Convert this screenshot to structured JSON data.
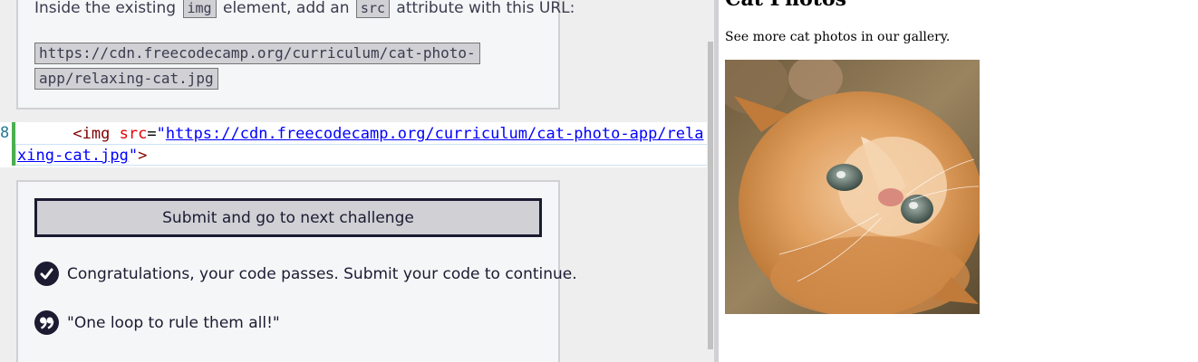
{
  "instructions": {
    "text_before": "Inside the existing",
    "code_img": "img",
    "text_middle": "element, add an",
    "code_src": "src",
    "text_after": "attribute with this URL:",
    "url_line1": "https://cdn.freecodecamp.org/curriculum/cat-photo-",
    "url_line2": "app/relaxing-cat.jpg"
  },
  "editor": {
    "line_number": "8",
    "open_bracket": "<",
    "tag": "img",
    "attr": "src",
    "eq": "=",
    "quote_open": "\"",
    "url_part1": "https://cdn.freecodecamp.org/curriculum/cat-photo-app/",
    "url_part2": "relaxing-cat.jpg",
    "quote_close": "\"",
    "close_bracket": ">"
  },
  "panel": {
    "submit_label": "Submit and go to next challenge",
    "success_message": "Congratulations, your code passes. Submit your code to continue.",
    "quote_message": "\"One loop to rule them all!\""
  },
  "preview": {
    "heading": "Cat Photos",
    "paragraph": "See more cat photos in our gallery."
  },
  "colors": {
    "gutter_modified": "#4caf50",
    "button_border": "#1b1b32",
    "panel_bg": "#f5f6f7"
  },
  "icons": {
    "success": "check-circle-icon",
    "quote": "quote-icon"
  }
}
